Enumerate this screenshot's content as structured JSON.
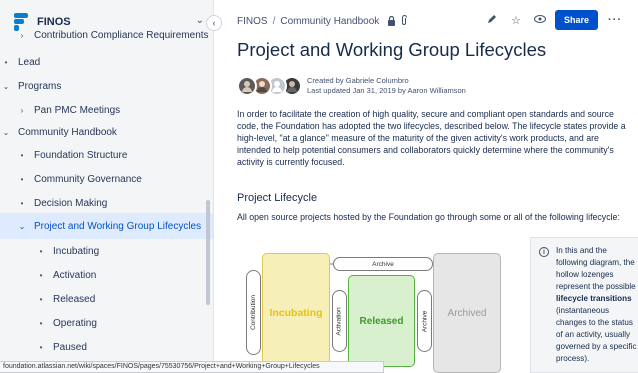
{
  "space": {
    "name": "FINOS"
  },
  "sidebar": {
    "items": [
      {
        "label": "Contribution Compliance Requirements",
        "mark": "›"
      },
      {
        "label": "Lead",
        "mark": "•"
      },
      {
        "label": "Programs",
        "mark": "⌄"
      },
      {
        "label": "Pan PMC Meetings",
        "mark": "›"
      },
      {
        "label": "Community Handbook",
        "mark": "⌄"
      },
      {
        "label": "Foundation Structure",
        "mark": "•"
      },
      {
        "label": "Community Governance",
        "mark": "•"
      },
      {
        "label": "Decision Making",
        "mark": "•"
      },
      {
        "label": "Project and Working Group Lifecycles",
        "mark": "⌄"
      },
      {
        "label": "Incubating",
        "mark": "•"
      },
      {
        "label": "Activation",
        "mark": "•"
      },
      {
        "label": "Released",
        "mark": "•"
      },
      {
        "label": "Operating",
        "mark": "•"
      },
      {
        "label": "Paused",
        "mark": "•"
      }
    ]
  },
  "breadcrumb": {
    "space": "FINOS",
    "separator": "/",
    "parent": "Community Handbook"
  },
  "toolbar": {
    "share_label": "Share"
  },
  "page": {
    "title": "Project and Working Group Lifecycles",
    "created_by": "Created by Gabriele Columbro",
    "last_updated": "Last updated Jan 31, 2019 by Aaron Williamson",
    "intro": "In order to facilitate the creation of high quality, secure and compliant open standards and source code, the Foundation has adopted the two lifecycles, described below. The lifecycle states provide a high-level, \"at a glance\" measure of the maturity of the given activity's work products, and are intended to help potential consumers and collaborators quickly determine where the community's activity is currently focused.",
    "section_heading": "Project Lifecycle",
    "lifecycle_text": "All open source projects hosted by the Foundation go through some or all of the following lifecycle:"
  },
  "diagram": {
    "states": [
      "Incubating",
      "Released",
      "Archived"
    ],
    "transitions": [
      "Archive",
      "Contribution",
      "Activation",
      "Archive"
    ]
  },
  "info_panel": {
    "before": "In this and the following diagram, the hollow lozenges represent the possible ",
    "bold": "lifecycle transitions",
    "after": " (instantaneous changes to the status of an activity, usually governed by a specific process)."
  },
  "status_bar": {
    "url": "foundation.atlassian.net/wiki/spaces/FINOS/pages/75530756/Project+and+Working+Group+Lifecycles"
  },
  "colors": {
    "incubating_fill": "#f7efb8",
    "incubating_text": "#e3c318",
    "released_fill": "#d9f0cf",
    "released_border": "#55b13e",
    "released_text": "#3f9a2b",
    "archived_fill": "#e6e6e6",
    "archived_text": "#9a9a9a",
    "accent": "#0052cc",
    "selected_bg": "#deebff"
  },
  "icons": [
    "space-logo",
    "chevron-down-icon",
    "collapse-icon",
    "lock-icon",
    "attachment-icon",
    "edit-icon",
    "star-icon",
    "watch-icon",
    "more-icon",
    "info-icon"
  ]
}
